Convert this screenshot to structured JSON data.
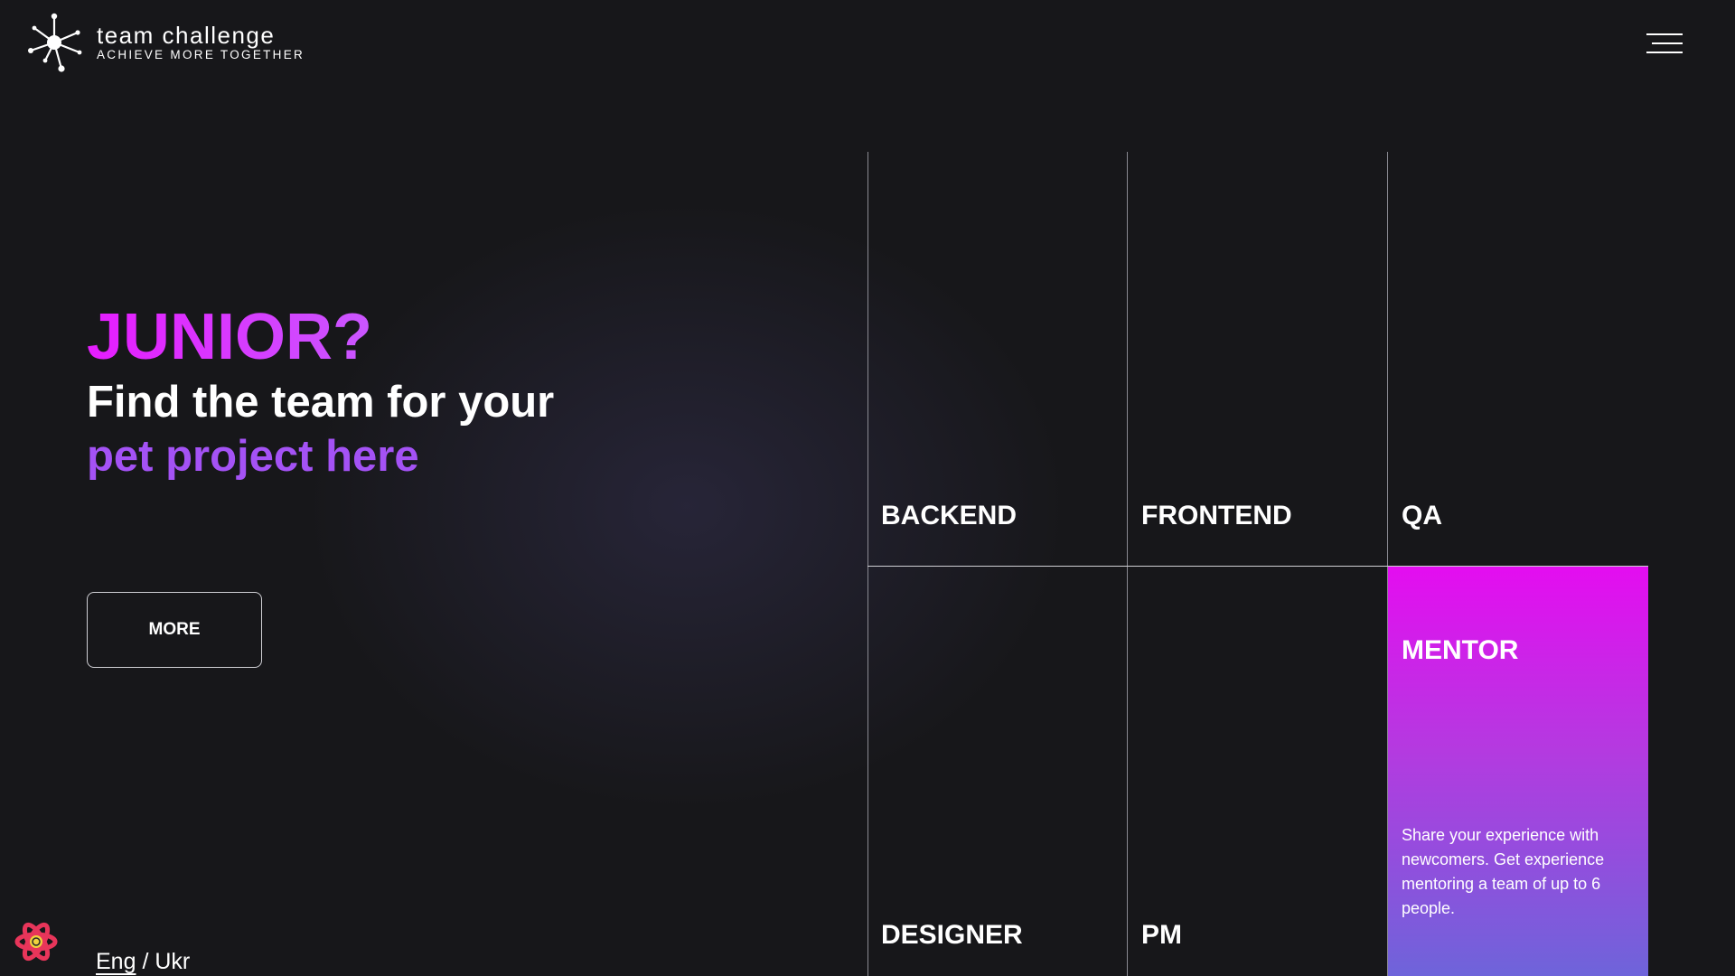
{
  "header": {
    "logo_icon": "network-nodes-icon",
    "title": "team challenge",
    "tagline": "ACHIEVE MORE TOGETHER",
    "menu_icon": "hamburger-menu-icon"
  },
  "hero": {
    "headline": "JUNIOR?",
    "line1": "Find the team for your",
    "line2": "pet project here",
    "more_button": "MORE"
  },
  "roles": {
    "backend": "BACKEND",
    "frontend": "FRONTEND",
    "qa": "QA",
    "designer": "DESIGNER",
    "pm": "PM",
    "mentor": {
      "title": "MENTOR",
      "description": "Share your experience with newcomers. Get experience mentoring a team of up to 6 people."
    }
  },
  "footer": {
    "react_icon": "react-atom-icon",
    "lang_eng": "Eng",
    "lang_separator": "/",
    "lang_ukr": "Ukr"
  },
  "colors": {
    "background": "#17171a",
    "accent_magenta": "#e61cff",
    "accent_purple": "#a452f5",
    "mentor_gradient_top": "#e40df0",
    "mentor_gradient_bottom": "#6e64da"
  }
}
